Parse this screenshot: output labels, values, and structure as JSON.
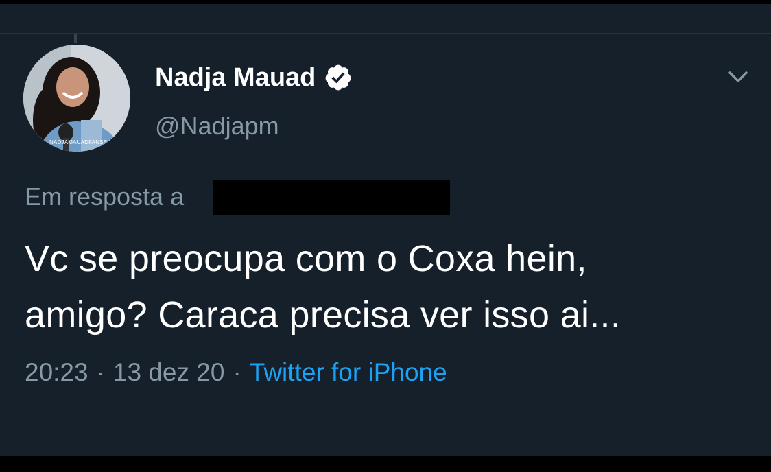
{
  "tweet": {
    "display_name": "Nadja Mauad",
    "handle": "@Nadjapm",
    "verified": true,
    "reply_label": "Em resposta a",
    "text_line1": "Vc se preocupa com o Coxa hein,",
    "text_line2": "amigo? Caraca precisa ver isso ai...",
    "time": "20:23",
    "date": "13 dez 20",
    "separator": "·",
    "source": "Twitter for iPhone"
  },
  "icons": {
    "verified": "verified-badge-icon",
    "menu": "chevron-down-icon",
    "avatar": "avatar-photo"
  },
  "colors": {
    "background": "#15202b",
    "primary_text": "#ffffff",
    "secondary_text": "#8899a6",
    "link": "#1da1f2",
    "redaction": "#000000"
  }
}
